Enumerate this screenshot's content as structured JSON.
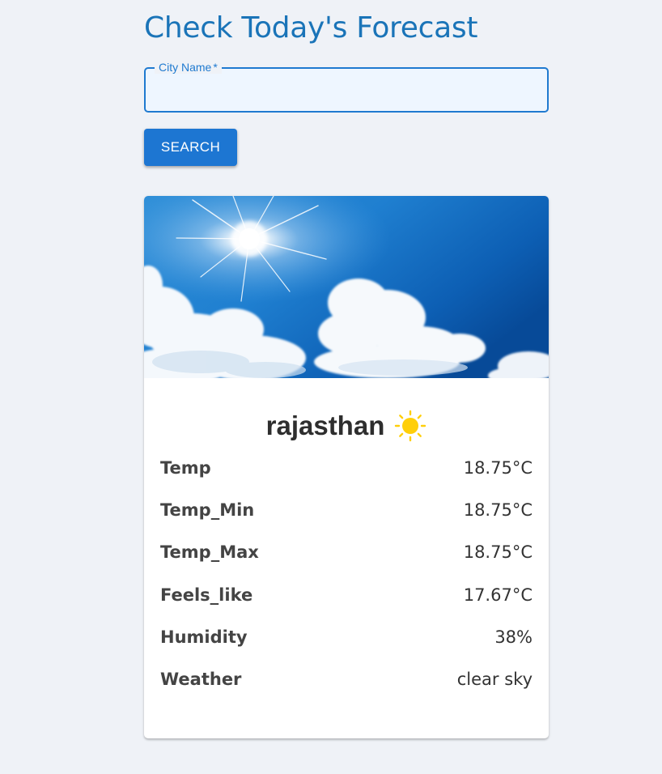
{
  "header": {
    "title": "Check Today's Forecast"
  },
  "search": {
    "label": "City Name",
    "required_mark": "*",
    "value": "",
    "placeholder": "",
    "button_label": "SEARCH"
  },
  "card": {
    "image_description_icon": "sky-sun-clouds-image",
    "city": "rajasthan",
    "weather_icon": "sun-icon",
    "rows": [
      {
        "label": "Temp",
        "value": "18.75°C"
      },
      {
        "label": "Temp_Min",
        "value": "18.75°C"
      },
      {
        "label": "Temp_Max",
        "value": "18.75°C"
      },
      {
        "label": "Feels_like",
        "value": "17.67°C"
      },
      {
        "label": "Humidity",
        "value": "38%"
      },
      {
        "label": "Weather",
        "value": "clear sky"
      }
    ]
  },
  "colors": {
    "background": "#eff2f7",
    "title": "#1a74b8",
    "accent": "#1d76d2",
    "sun": "#ffcf0a"
  }
}
